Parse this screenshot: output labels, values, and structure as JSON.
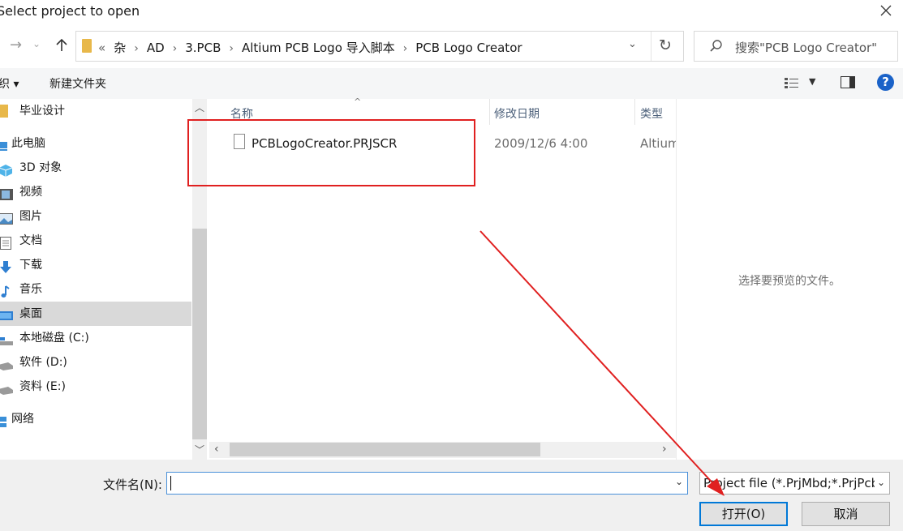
{
  "window": {
    "title": "Select project to open"
  },
  "address": {
    "crumbs": [
      "«",
      "杂",
      "AD",
      "3.PCB",
      "Altium PCB Logo 导入脚本",
      "PCB Logo Creator"
    ]
  },
  "search": {
    "placeholder": "搜索\"PCB Logo Creator\""
  },
  "toolbar": {
    "organize_label": "织 ▾",
    "new_folder_label": "新建文件夹"
  },
  "nav": {
    "items": [
      {
        "label": "毕业设计",
        "icon": "folder-icon"
      },
      {
        "label": "此电脑",
        "icon": "computer-icon"
      },
      {
        "label": "3D 对象",
        "icon": "cube-icon"
      },
      {
        "label": "视频",
        "icon": "film-icon"
      },
      {
        "label": "图片",
        "icon": "picture-icon"
      },
      {
        "label": "文档",
        "icon": "document-icon"
      },
      {
        "label": "下载",
        "icon": "download-icon"
      },
      {
        "label": "音乐",
        "icon": "music-icon"
      },
      {
        "label": "桌面",
        "icon": "desktop-icon"
      },
      {
        "label": "本地磁盘 (C:)",
        "icon": "drive-icon"
      },
      {
        "label": "软件 (D:)",
        "icon": "drive-icon"
      },
      {
        "label": "资料 (E:)",
        "icon": "drive-icon"
      },
      {
        "label": "网络",
        "icon": "network-icon"
      }
    ],
    "selected": "桌面"
  },
  "list": {
    "columns": {
      "name": "名称",
      "date": "修改日期",
      "type": "类型"
    },
    "rows": [
      {
        "name": "PCBLogoCreator.PRJSCR",
        "date": "2009/12/6 4:00",
        "type": "Altium"
      }
    ]
  },
  "preview": {
    "empty_text": "选择要预览的文件。"
  },
  "footer": {
    "filename_label": "文件名(N):",
    "filename_value": "",
    "filter_value": "Project file (*.PrjMbd;*.PrjPcb",
    "open_label": "打开(O)",
    "cancel_label": "取消"
  },
  "colors": {
    "accent": "#0078d7",
    "annotation": "#e02020",
    "folder": "#e8b84a"
  }
}
